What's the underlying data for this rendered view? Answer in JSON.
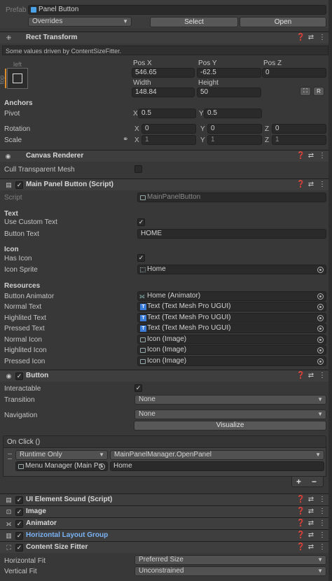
{
  "prefab": {
    "label": "Prefab",
    "name": "Panel Button",
    "overrides": "Overrides",
    "select": "Select",
    "open": "Open"
  },
  "rect_transform": {
    "title": "Rect Transform",
    "driven_note": "Some values driven by ContentSizeFitter.",
    "anchor_preset_h": "left",
    "anchor_preset_v": "top",
    "pos_x_label": "Pos X",
    "pos_y_label": "Pos Y",
    "pos_z_label": "Pos Z",
    "pos_x": "546.65",
    "pos_y": "-62.5",
    "pos_z": "0",
    "width_label": "Width",
    "height_label": "Height",
    "width": "148.84",
    "height": "50",
    "r_button": "R",
    "anchors_label": "Anchors",
    "pivot_label": "Pivot",
    "pivot_x": "0.5",
    "pivot_y": "0.5",
    "rotation_label": "Rotation",
    "rot_x": "0",
    "rot_y": "0",
    "rot_z": "0",
    "scale_label": "Scale",
    "scale_x": "1",
    "scale_y": "1",
    "scale_z": "1",
    "axis_x": "X",
    "axis_y": "Y",
    "axis_z": "Z"
  },
  "canvas_renderer": {
    "title": "Canvas Renderer",
    "cull_label": "Cull Transparent Mesh"
  },
  "main_panel_button": {
    "title": "Main Panel Button (Script)",
    "script_label": "Script",
    "script_value": "MainPanelButton",
    "text_header": "Text",
    "use_custom_text_label": "Use Custom Text",
    "button_text_label": "Button Text",
    "button_text_value": "HOME",
    "icon_header": "Icon",
    "has_icon_label": "Has Icon",
    "icon_sprite_label": "Icon Sprite",
    "icon_sprite_value": "Home",
    "resources_header": "Resources",
    "rows": [
      {
        "label": "Button Animator",
        "value": "Home (Animator)"
      },
      {
        "label": "Normal Text",
        "value": "Text (Text Mesh Pro UGUI)"
      },
      {
        "label": "Highlited Text",
        "value": "Text (Text Mesh Pro UGUI)"
      },
      {
        "label": "Pressed Text",
        "value": "Text (Text Mesh Pro UGUI)"
      },
      {
        "label": "Normal Icon",
        "value": "Icon (Image)"
      },
      {
        "label": "Highlited Icon",
        "value": "Icon (Image)"
      },
      {
        "label": "Pressed Icon",
        "value": "Icon (Image)"
      }
    ]
  },
  "button": {
    "title": "Button",
    "interactable_label": "Interactable",
    "transition_label": "Transition",
    "transition_value": "None",
    "navigation_label": "Navigation",
    "navigation_value": "None",
    "visualize": "Visualize",
    "onclick_label": "On Click ()",
    "runtime": "Runtime Only",
    "function": "MainPanelManager.OpenPanel",
    "target": "Menu Manager (Main Pa",
    "argument": "Home",
    "plus": "+",
    "minus": "−"
  },
  "components": [
    {
      "title": "UI Element Sound (Script)"
    },
    {
      "title": "Image"
    },
    {
      "title": "Animator"
    },
    {
      "title": "Horizontal Layout Group"
    },
    {
      "title": "Content Size Fitter"
    }
  ],
  "content_size_fitter": {
    "horizontal_label": "Horizontal Fit",
    "horizontal_value": "Preferred Size",
    "vertical_label": "Vertical Fit",
    "vertical_value": "Unconstrained"
  },
  "colors": {
    "background": "#383838",
    "field": "#2a2a2a",
    "header": "#3e3e3e",
    "link_blue": "#7ab3f5",
    "tmp_blue": "#3b7dd8"
  }
}
